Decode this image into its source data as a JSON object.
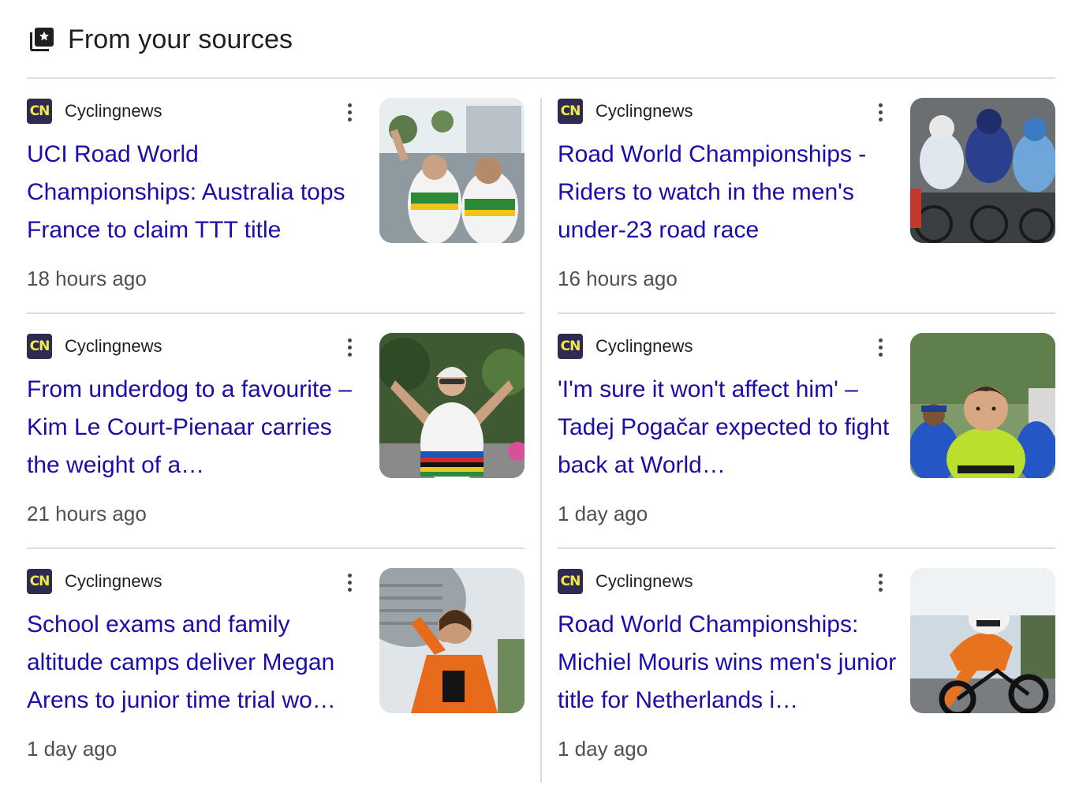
{
  "section": {
    "title": "From your sources",
    "icon": "starred-stack-icon"
  },
  "articles": [
    {
      "source": "Cyclingnews",
      "logo_text": "CN",
      "headline": "UCI Road World Championships: Australia tops France to claim TTT title",
      "time": "18 hours ago"
    },
    {
      "source": "Cyclingnews",
      "logo_text": "CN",
      "headline": "Road World Championships - Riders to watch in the men's under-23 road race",
      "time": "16 hours ago"
    },
    {
      "source": "Cyclingnews",
      "logo_text": "CN",
      "headline": "From underdog to a favourite – Kim Le Court-Pienaar carries the weight of a…",
      "time": "21 hours ago"
    },
    {
      "source": "Cyclingnews",
      "logo_text": "CN",
      "headline": "'I'm sure it won't affect him' – Tadej Pogačar expected to fight back at World…",
      "time": "1 day ago"
    },
    {
      "source": "Cyclingnews",
      "logo_text": "CN",
      "headline": "School exams and family altitude camps deliver Megan Arens to junior time trial wo…",
      "time": "1 day ago"
    },
    {
      "source": "Cyclingnews",
      "logo_text": "CN",
      "headline": "Road World Championships: Michiel Mouris wins men's junior title for Netherlands i…",
      "time": "1 day ago"
    }
  ],
  "colors": {
    "headline": "#1a0dab",
    "text": "#1f1f1f",
    "muted": "#4d5156",
    "divider": "#dadce0",
    "logo_bg": "#2e2a52",
    "logo_fg": "#f3e94c"
  }
}
